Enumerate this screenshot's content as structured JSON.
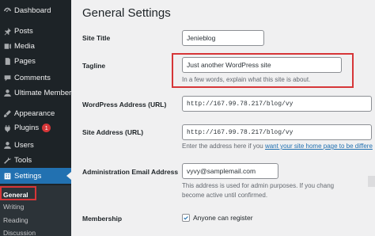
{
  "sidebar": {
    "items": [
      {
        "label": "Dashboard",
        "icon": "dashboard-icon"
      },
      {
        "label": "Posts",
        "icon": "pin-icon"
      },
      {
        "label": "Media",
        "icon": "media-icon"
      },
      {
        "label": "Pages",
        "icon": "pages-icon"
      },
      {
        "label": "Comments",
        "icon": "comments-icon"
      },
      {
        "label": "Ultimate Member",
        "icon": "users-icon"
      },
      {
        "label": "Appearance",
        "icon": "appearance-icon"
      },
      {
        "label": "Plugins",
        "icon": "plugins-icon",
        "badge": "1"
      },
      {
        "label": "Users",
        "icon": "users-icon"
      },
      {
        "label": "Tools",
        "icon": "tools-icon"
      },
      {
        "label": "Settings",
        "icon": "settings-icon",
        "active": true
      }
    ],
    "submenu": [
      "General",
      "Writing",
      "Reading",
      "Discussion"
    ],
    "current_submenu": "General",
    "colors": {
      "background": "#1d2327",
      "active": "#2271b1",
      "badge": "#d63638"
    }
  },
  "main": {
    "title": "General Settings",
    "rows": {
      "site_title": {
        "label": "Site Title",
        "value": "Jenieblog"
      },
      "tagline": {
        "label": "Tagline",
        "value": "Just another WordPress site",
        "description": "In a few words, explain what this site is about."
      },
      "wp_address": {
        "label": "WordPress Address (URL)",
        "value": "http://167.99.78.217/blog/vy"
      },
      "site_address": {
        "label": "Site Address (URL)",
        "value": "http://167.99.78.217/blog/vy",
        "description_prefix": "Enter the address here if you ",
        "description_link": "want your site home page to be differe"
      },
      "admin_email": {
        "label": "Administration Email Address",
        "value": "vyvy@samplemail.com",
        "description_line1": "This address is used for admin purposes. If you chang",
        "description_line2": "become active until confirmed."
      },
      "membership": {
        "label": "Membership",
        "checkbox_label": "Anyone can register",
        "checked": true
      }
    },
    "highlight_color": "#d63638"
  }
}
